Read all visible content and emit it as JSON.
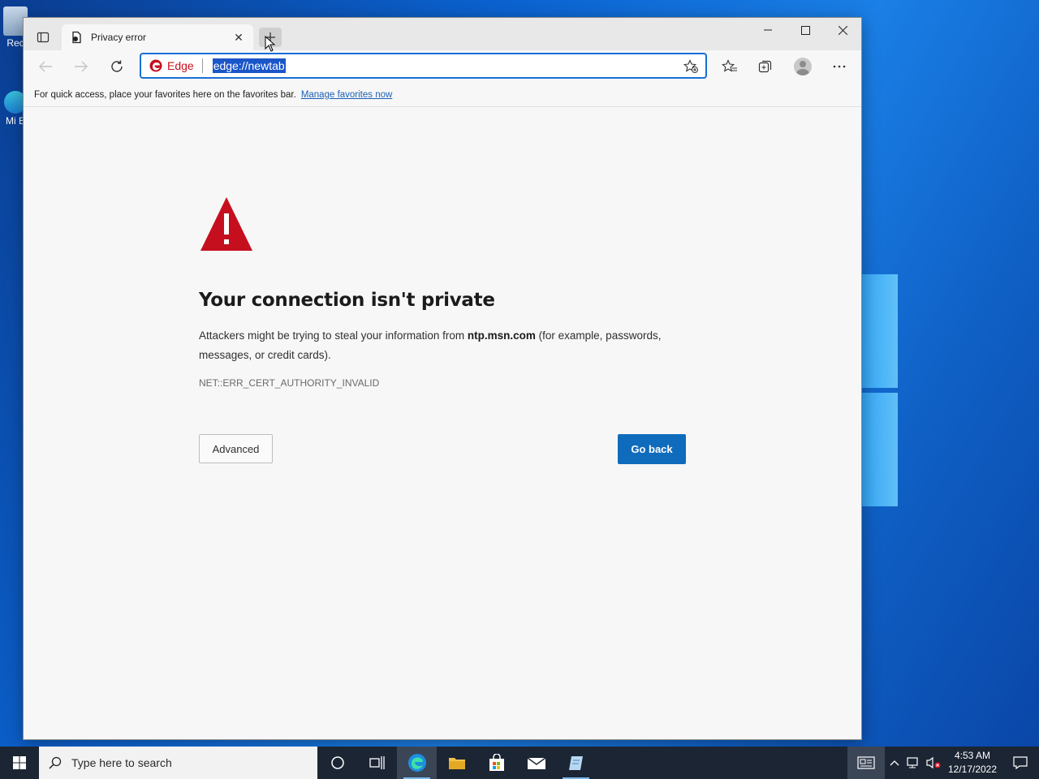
{
  "desktop": {
    "icons": [
      {
        "label": "Rec"
      },
      {
        "label": "Mi E"
      }
    ]
  },
  "browser": {
    "tab": {
      "title": "Privacy error"
    },
    "address": {
      "chip_label": "Edge",
      "url": "edge://newtab"
    },
    "favorites_bar": {
      "text": "For quick access, place your favorites here on the favorites bar.",
      "link": "Manage favorites now"
    },
    "page": {
      "heading": "Your connection isn't private",
      "desc_before": "Attackers might be trying to steal your information from ",
      "desc_host": "ntp.msn.com",
      "desc_after": " (for example, passwords, messages, or credit cards).",
      "error_code": "NET::ERR_CERT_AUTHORITY_INVALID",
      "advanced_label": "Advanced",
      "go_back_label": "Go back"
    }
  },
  "taskbar": {
    "search_placeholder": "Type here to search",
    "time": "4:53 AM",
    "date": "12/17/2022"
  },
  "colors": {
    "accent": "#0f6cbd",
    "warning": "#c50f1f"
  }
}
